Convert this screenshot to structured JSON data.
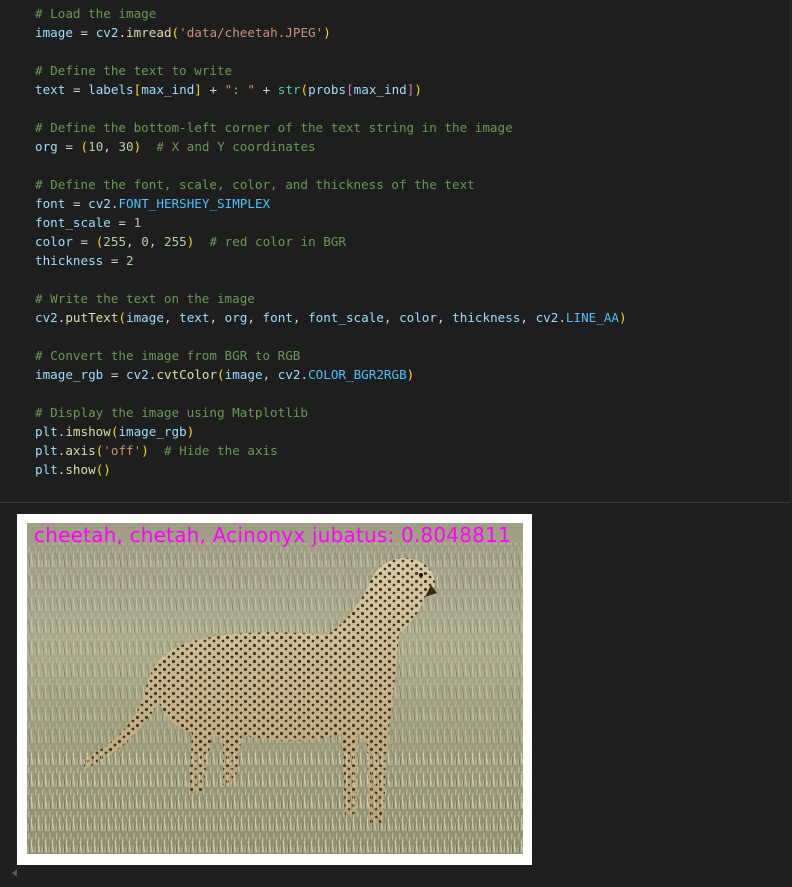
{
  "code": {
    "lines": [
      "# Load the image",
      "image = cv2.imread('data/cheetah.JPEG')",
      "",
      "# Define the text to write",
      "text = labels[max_ind] + \": \" + str(probs[max_ind])",
      "",
      "# Define the bottom-left corner of the text string in the image",
      "org = (10, 30)  # X and Y coordinates",
      "",
      "# Define the font, scale, color, and thickness of the text",
      "font = cv2.FONT_HERSHEY_SIMPLEX",
      "font_scale = 1",
      "color = (255, 0, 255)  # red color in BGR",
      "thickness = 2",
      "",
      "# Write the text on the image",
      "cv2.putText(image, text, org, font, font_scale, color, thickness, cv2.LINE_AA)",
      "",
      "# Convert the image from BGR to RGB",
      "image_rgb = cv2.cvtColor(image, cv2.COLOR_BGR2RGB)",
      "",
      "# Display the image using Matplotlib",
      "plt.imshow(image_rgb)",
      "plt.axis('off')  # Hide the axis",
      "plt.show()"
    ]
  },
  "output": {
    "image_caption": "cheetah, chetah, Acinonyx jubatus: 0.8048811",
    "caption_color": "#ff00ff",
    "image_subject": "cheetah-standing-in-grass"
  },
  "colors": {
    "editor_bg": "#1e1e1e",
    "comment": "#6a9955",
    "variable": "#9cdcfe",
    "string": "#ce9178",
    "number": "#b5cea8",
    "function": "#dcdcaa"
  }
}
